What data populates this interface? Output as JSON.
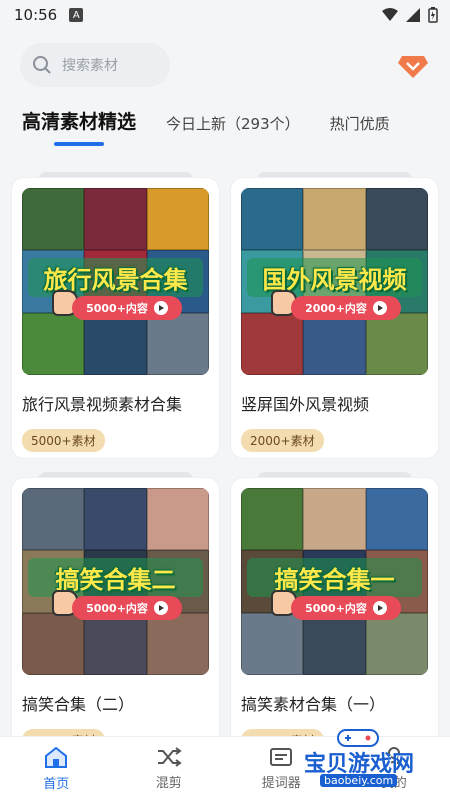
{
  "status": {
    "time": "10:56",
    "notif": "A"
  },
  "search": {
    "placeholder": "搜索素材"
  },
  "tabs": [
    {
      "label": "高清素材精选"
    },
    {
      "label": "今日上新（293个）"
    },
    {
      "label": "热门优质"
    }
  ],
  "cards": [
    {
      "banner": "旅行风景合集",
      "pill": "5000+内容",
      "title": "旅行风景视频素材合集",
      "badge": "5000+素材",
      "colors": [
        "#3f6b3a",
        "#7a2a3a",
        "#d89a2a",
        "#3a7aa0",
        "#a02a3a",
        "#2a5a8a",
        "#4a8a3a",
        "#2a4a6a",
        "#6a7a8a"
      ]
    },
    {
      "banner": "国外风景视频",
      "pill": "2000+内容",
      "title": "竖屏国外风景视频",
      "badge": "2000+素材",
      "colors": [
        "#2a6a8a",
        "#c9a870",
        "#3a4a5a",
        "#3a9aa0",
        "#c9b890",
        "#2a7a6a",
        "#a03a3a",
        "#3a5a8a",
        "#6a8a4a"
      ]
    },
    {
      "banner": "搞笑合集二",
      "pill": "5000+内容",
      "title": "搞笑合集（二）",
      "badge": "5000+素材",
      "colors": [
        "#5a6a7a",
        "#3a4a6a",
        "#c99a8a",
        "#8a7a5a",
        "#2a3a4a",
        "#6a5a4a",
        "#7a5a4a",
        "#4a4a5a",
        "#8a6a5a"
      ]
    },
    {
      "banner": "搞笑合集一",
      "pill": "5000+内容",
      "title": "搞笑素材合集（一）",
      "badge": "5000+素材",
      "colors": [
        "#4a7a3a",
        "#c9a88a",
        "#3a6aa0",
        "#5a4a3a",
        "#2a3a5a",
        "#8a5a4a",
        "#6a7a8a",
        "#3a4a5a",
        "#7a8a6a"
      ]
    }
  ],
  "nav": [
    {
      "label": "首页",
      "icon": "home-icon"
    },
    {
      "label": "混剪",
      "icon": "shuffle-icon"
    },
    {
      "label": "提词器",
      "icon": "teleprompter-icon"
    },
    {
      "label": "我的",
      "icon": "profile-icon"
    }
  ],
  "watermark": {
    "text": "宝贝游戏网",
    "url": "baobeiy.com"
  },
  "colors": {
    "accent": "#1f6fe8",
    "badge_bg": "#f3dcb0",
    "pill": "#e94a58"
  }
}
